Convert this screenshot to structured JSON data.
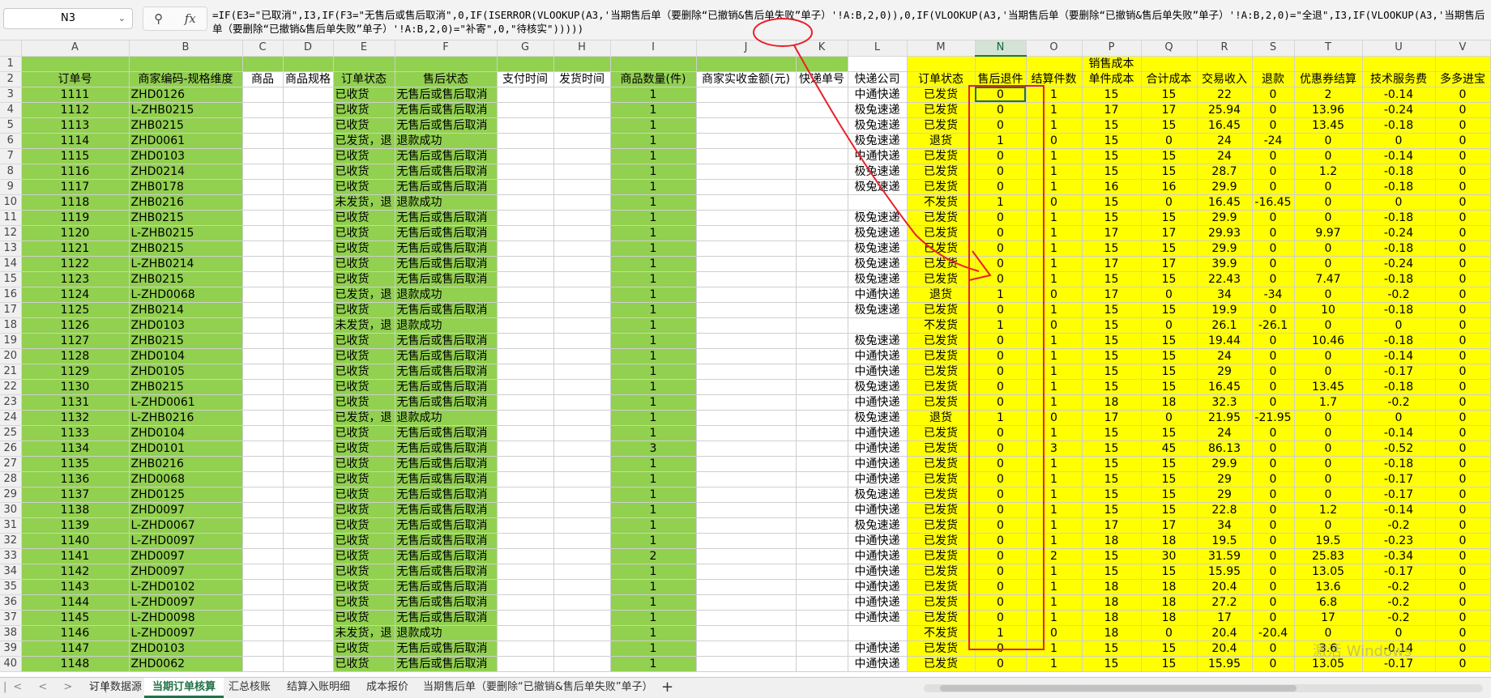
{
  "name_box": "N3",
  "fx_icons": [
    "zoom-icon",
    "function-icon"
  ],
  "fx_label": "fx",
  "formula": "=IF(E3=\"已取消\",I3,IF(F3=\"无售后或售后取消\",0,IF(ISERROR(VLOOKUP(A3,'当期售后单（要删除“已撤销&售后单失败”单子）'!A:B,2,0)),0,IF(VLOOKUP(A3,'当期售后单（要删除“已撤销&售后单失败”单子）'!A:B,2,0)=\"全退\",I3,IF(VLOOKUP(A3,'当期售后单（要删除“已撤销&售后单失败”单子）'!A:B,2,0)=\"补寄\",0,\"待核实\")))))",
  "columns": [
    {
      "letter": "A",
      "width": 133
    },
    {
      "letter": "B",
      "width": 140
    },
    {
      "letter": "C",
      "width": 50
    },
    {
      "letter": "D",
      "width": 62
    },
    {
      "letter": "E",
      "width": 76
    },
    {
      "letter": "F",
      "width": 126
    },
    {
      "letter": "G",
      "width": 70
    },
    {
      "letter": "H",
      "width": 70
    },
    {
      "letter": "I",
      "width": 106
    },
    {
      "letter": "J",
      "width": 123
    },
    {
      "letter": "K",
      "width": 64
    },
    {
      "letter": "L",
      "width": 73
    },
    {
      "letter": "M",
      "width": 84
    },
    {
      "letter": "N",
      "width": 63
    },
    {
      "letter": "O",
      "width": 69
    },
    {
      "letter": "P",
      "width": 73
    },
    {
      "letter": "Q",
      "width": 69
    },
    {
      "letter": "R",
      "width": 68
    },
    {
      "letter": "S",
      "width": 52
    },
    {
      "letter": "T",
      "width": 84
    },
    {
      "letter": "U",
      "width": 90
    },
    {
      "letter": "V",
      "width": 68
    }
  ],
  "row1": {
    "merged_title": "销售成本"
  },
  "headers": [
    "订单号",
    "商家编码-规格维度",
    "商品",
    "商品规格",
    "订单状态",
    "售后状态",
    "支付时间",
    "发货时间",
    "商品数量(件)",
    "商家实收金额(元)",
    "快递单号",
    "快递公司",
    "订单状态",
    "售后退件",
    "结算件数",
    "单件成本",
    "合计成本",
    "交易收入",
    "退款",
    "优惠券结算",
    "技术服务费",
    "多多进宝"
  ],
  "rows": [
    {
      "r": "3",
      "a": "1111",
      "b": "ZHD0126",
      "e": "已收货",
      "f": "无售后或售后取消",
      "i": "1",
      "l": "中通快递",
      "m": "已发货",
      "n": "0",
      "o": "1",
      "p": "15",
      "q": "15",
      "rr": "22",
      "s": "0",
      "t": "2",
      "u": "-0.14",
      "v": "0"
    },
    {
      "r": "4",
      "a": "1112",
      "b": "L-ZHB0215",
      "e": "已收货",
      "f": "无售后或售后取消",
      "i": "1",
      "l": "极兔速递",
      "m": "已发货",
      "n": "0",
      "o": "1",
      "p": "17",
      "q": "17",
      "rr": "25.94",
      "s": "0",
      "t": "13.96",
      "u": "-0.24",
      "v": "0"
    },
    {
      "r": "5",
      "a": "1113",
      "b": "ZHB0215",
      "e": "已收货",
      "f": "无售后或售后取消",
      "i": "1",
      "l": "极兔速递",
      "m": "已发货",
      "n": "0",
      "o": "1",
      "p": "15",
      "q": "15",
      "rr": "16.45",
      "s": "0",
      "t": "13.45",
      "u": "-0.18",
      "v": "0"
    },
    {
      "r": "6",
      "a": "1114",
      "b": "ZHD0061",
      "e": "已发货，退",
      "f": "退款成功",
      "i": "1",
      "l": "极兔速递",
      "m": "退货",
      "n": "1",
      "o": "0",
      "p": "15",
      "q": "0",
      "rr": "24",
      "s": "-24",
      "t": "0",
      "u": "0",
      "v": "0"
    },
    {
      "r": "7",
      "a": "1115",
      "b": "ZHD0103",
      "e": "已收货",
      "f": "无售后或售后取消",
      "i": "1",
      "l": "中通快递",
      "m": "已发货",
      "n": "0",
      "o": "1",
      "p": "15",
      "q": "15",
      "rr": "24",
      "s": "0",
      "t": "0",
      "u": "-0.14",
      "v": "0"
    },
    {
      "r": "8",
      "a": "1116",
      "b": "ZHD0214",
      "e": "已收货",
      "f": "无售后或售后取消",
      "i": "1",
      "l": "极兔速递",
      "m": "已发货",
      "n": "0",
      "o": "1",
      "p": "15",
      "q": "15",
      "rr": "28.7",
      "s": "0",
      "t": "1.2",
      "u": "-0.18",
      "v": "0"
    },
    {
      "r": "9",
      "a": "1117",
      "b": "ZHB0178",
      "e": "已收货",
      "f": "无售后或售后取消",
      "i": "1",
      "l": "极兔速递",
      "m": "已发货",
      "n": "0",
      "o": "1",
      "p": "16",
      "q": "16",
      "rr": "29.9",
      "s": "0",
      "t": "0",
      "u": "-0.18",
      "v": "0"
    },
    {
      "r": "10",
      "a": "1118",
      "b": "ZHB0216",
      "e": "未发货，退",
      "f": "退款成功",
      "i": "1",
      "l": "",
      "m": "不发货",
      "n": "1",
      "o": "0",
      "p": "15",
      "q": "0",
      "rr": "16.45",
      "s": "-16.45",
      "t": "0",
      "u": "0",
      "v": "0"
    },
    {
      "r": "11",
      "a": "1119",
      "b": "ZHB0215",
      "e": "已收货",
      "f": "无售后或售后取消",
      "i": "1",
      "l": "极兔速递",
      "m": "已发货",
      "n": "0",
      "o": "1",
      "p": "15",
      "q": "15",
      "rr": "29.9",
      "s": "0",
      "t": "0",
      "u": "-0.18",
      "v": "0"
    },
    {
      "r": "12",
      "a": "1120",
      "b": "L-ZHB0215",
      "e": "已收货",
      "f": "无售后或售后取消",
      "i": "1",
      "l": "极兔速递",
      "m": "已发货",
      "n": "0",
      "o": "1",
      "p": "17",
      "q": "17",
      "rr": "29.93",
      "s": "0",
      "t": "9.97",
      "u": "-0.24",
      "v": "0"
    },
    {
      "r": "13",
      "a": "1121",
      "b": "ZHB0215",
      "e": "已收货",
      "f": "无售后或售后取消",
      "i": "1",
      "l": "极兔速递",
      "m": "已发货",
      "n": "0",
      "o": "1",
      "p": "15",
      "q": "15",
      "rr": "29.9",
      "s": "0",
      "t": "0",
      "u": "-0.18",
      "v": "0"
    },
    {
      "r": "14",
      "a": "1122",
      "b": "L-ZHB0214",
      "e": "已收货",
      "f": "无售后或售后取消",
      "i": "1",
      "l": "极兔速递",
      "m": "已发货",
      "n": "0",
      "o": "1",
      "p": "17",
      "q": "17",
      "rr": "39.9",
      "s": "0",
      "t": "0",
      "u": "-0.24",
      "v": "0"
    },
    {
      "r": "15",
      "a": "1123",
      "b": "ZHB0215",
      "e": "已收货",
      "f": "无售后或售后取消",
      "i": "1",
      "l": "极兔速递",
      "m": "已发货",
      "n": "0",
      "o": "1",
      "p": "15",
      "q": "15",
      "rr": "22.43",
      "s": "0",
      "t": "7.47",
      "u": "-0.18",
      "v": "0"
    },
    {
      "r": "16",
      "a": "1124",
      "b": "L-ZHD0068",
      "e": "已发货，退",
      "f": "退款成功",
      "i": "1",
      "l": "中通快递",
      "m": "退货",
      "n": "1",
      "o": "0",
      "p": "17",
      "q": "0",
      "rr": "34",
      "s": "-34",
      "t": "0",
      "u": "-0.2",
      "v": "0"
    },
    {
      "r": "17",
      "a": "1125",
      "b": "ZHB0214",
      "e": "已收货",
      "f": "无售后或售后取消",
      "i": "1",
      "l": "极兔速递",
      "m": "已发货",
      "n": "0",
      "o": "1",
      "p": "15",
      "q": "15",
      "rr": "19.9",
      "s": "0",
      "t": "10",
      "u": "-0.18",
      "v": "0"
    },
    {
      "r": "18",
      "a": "1126",
      "b": "ZHD0103",
      "e": "未发货，退",
      "f": "退款成功",
      "i": "1",
      "l": "",
      "m": "不发货",
      "n": "1",
      "o": "0",
      "p": "15",
      "q": "0",
      "rr": "26.1",
      "s": "-26.1",
      "t": "0",
      "u": "0",
      "v": "0"
    },
    {
      "r": "19",
      "a": "1127",
      "b": "ZHB0215",
      "e": "已收货",
      "f": "无售后或售后取消",
      "i": "1",
      "l": "极兔速递",
      "m": "已发货",
      "n": "0",
      "o": "1",
      "p": "15",
      "q": "15",
      "rr": "19.44",
      "s": "0",
      "t": "10.46",
      "u": "-0.18",
      "v": "0"
    },
    {
      "r": "20",
      "a": "1128",
      "b": "ZHD0104",
      "e": "已收货",
      "f": "无售后或售后取消",
      "i": "1",
      "l": "中通快递",
      "m": "已发货",
      "n": "0",
      "o": "1",
      "p": "15",
      "q": "15",
      "rr": "24",
      "s": "0",
      "t": "0",
      "u": "-0.14",
      "v": "0"
    },
    {
      "r": "21",
      "a": "1129",
      "b": "ZHD0105",
      "e": "已收货",
      "f": "无售后或售后取消",
      "i": "1",
      "l": "中通快递",
      "m": "已发货",
      "n": "0",
      "o": "1",
      "p": "15",
      "q": "15",
      "rr": "29",
      "s": "0",
      "t": "0",
      "u": "-0.17",
      "v": "0"
    },
    {
      "r": "22",
      "a": "1130",
      "b": "ZHB0215",
      "e": "已收货",
      "f": "无售后或售后取消",
      "i": "1",
      "l": "极兔速递",
      "m": "已发货",
      "n": "0",
      "o": "1",
      "p": "15",
      "q": "15",
      "rr": "16.45",
      "s": "0",
      "t": "13.45",
      "u": "-0.18",
      "v": "0"
    },
    {
      "r": "23",
      "a": "1131",
      "b": "L-ZHD0061",
      "e": "已收货",
      "f": "无售后或售后取消",
      "i": "1",
      "l": "中通快递",
      "m": "已发货",
      "n": "0",
      "o": "1",
      "p": "18",
      "q": "18",
      "rr": "32.3",
      "s": "0",
      "t": "1.7",
      "u": "-0.2",
      "v": "0"
    },
    {
      "r": "24",
      "a": "1132",
      "b": "L-ZHB0216",
      "e": "已发货，退",
      "f": "退款成功",
      "i": "1",
      "l": "极兔速递",
      "m": "退货",
      "n": "1",
      "o": "0",
      "p": "17",
      "q": "0",
      "rr": "21.95",
      "s": "-21.95",
      "t": "0",
      "u": "0",
      "v": "0"
    },
    {
      "r": "25",
      "a": "1133",
      "b": "ZHD0104",
      "e": "已收货",
      "f": "无售后或售后取消",
      "i": "1",
      "l": "中通快递",
      "m": "已发货",
      "n": "0",
      "o": "1",
      "p": "15",
      "q": "15",
      "rr": "24",
      "s": "0",
      "t": "0",
      "u": "-0.14",
      "v": "0"
    },
    {
      "r": "26",
      "a": "1134",
      "b": "ZHD0101",
      "e": "已收货",
      "f": "无售后或售后取消",
      "i": "3",
      "l": "中通快递",
      "m": "已发货",
      "n": "0",
      "o": "3",
      "p": "15",
      "q": "45",
      "rr": "86.13",
      "s": "0",
      "t": "0",
      "u": "-0.52",
      "v": "0"
    },
    {
      "r": "27",
      "a": "1135",
      "b": "ZHB0216",
      "e": "已收货",
      "f": "无售后或售后取消",
      "i": "1",
      "l": "中通快递",
      "m": "已发货",
      "n": "0",
      "o": "1",
      "p": "15",
      "q": "15",
      "rr": "29.9",
      "s": "0",
      "t": "0",
      "u": "-0.18",
      "v": "0"
    },
    {
      "r": "28",
      "a": "1136",
      "b": "ZHD0068",
      "e": "已收货",
      "f": "无售后或售后取消",
      "i": "1",
      "l": "中通快递",
      "m": "已发货",
      "n": "0",
      "o": "1",
      "p": "15",
      "q": "15",
      "rr": "29",
      "s": "0",
      "t": "0",
      "u": "-0.17",
      "v": "0"
    },
    {
      "r": "29",
      "a": "1137",
      "b": "ZHD0125",
      "e": "已收货",
      "f": "无售后或售后取消",
      "i": "1",
      "l": "极兔速递",
      "m": "已发货",
      "n": "0",
      "o": "1",
      "p": "15",
      "q": "15",
      "rr": "29",
      "s": "0",
      "t": "0",
      "u": "-0.17",
      "v": "0"
    },
    {
      "r": "30",
      "a": "1138",
      "b": "ZHD0097",
      "e": "已收货",
      "f": "无售后或售后取消",
      "i": "1",
      "l": "中通快递",
      "m": "已发货",
      "n": "0",
      "o": "1",
      "p": "15",
      "q": "15",
      "rr": "22.8",
      "s": "0",
      "t": "1.2",
      "u": "-0.14",
      "v": "0"
    },
    {
      "r": "31",
      "a": "1139",
      "b": "L-ZHD0067",
      "e": "已收货",
      "f": "无售后或售后取消",
      "i": "1",
      "l": "极兔速递",
      "m": "已发货",
      "n": "0",
      "o": "1",
      "p": "17",
      "q": "17",
      "rr": "34",
      "s": "0",
      "t": "0",
      "u": "-0.2",
      "v": "0"
    },
    {
      "r": "32",
      "a": "1140",
      "b": "L-ZHD0097",
      "e": "已收货",
      "f": "无售后或售后取消",
      "i": "1",
      "l": "中通快递",
      "m": "已发货",
      "n": "0",
      "o": "1",
      "p": "18",
      "q": "18",
      "rr": "19.5",
      "s": "0",
      "t": "19.5",
      "u": "-0.23",
      "v": "0"
    },
    {
      "r": "33",
      "a": "1141",
      "b": "ZHD0097",
      "e": "已收货",
      "f": "无售后或售后取消",
      "i": "2",
      "l": "中通快递",
      "m": "已发货",
      "n": "0",
      "o": "2",
      "p": "15",
      "q": "30",
      "rr": "31.59",
      "s": "0",
      "t": "25.83",
      "u": "-0.34",
      "v": "0"
    },
    {
      "r": "34",
      "a": "1142",
      "b": "ZHD0097",
      "e": "已收货",
      "f": "无售后或售后取消",
      "i": "1",
      "l": "中通快递",
      "m": "已发货",
      "n": "0",
      "o": "1",
      "p": "15",
      "q": "15",
      "rr": "15.95",
      "s": "0",
      "t": "13.05",
      "u": "-0.17",
      "v": "0"
    },
    {
      "r": "35",
      "a": "1143",
      "b": "L-ZHD0102",
      "e": "已收货",
      "f": "无售后或售后取消",
      "i": "1",
      "l": "中通快递",
      "m": "已发货",
      "n": "0",
      "o": "1",
      "p": "18",
      "q": "18",
      "rr": "20.4",
      "s": "0",
      "t": "13.6",
      "u": "-0.2",
      "v": "0"
    },
    {
      "r": "36",
      "a": "1144",
      "b": "L-ZHD0097",
      "e": "已收货",
      "f": "无售后或售后取消",
      "i": "1",
      "l": "中通快递",
      "m": "已发货",
      "n": "0",
      "o": "1",
      "p": "18",
      "q": "18",
      "rr": "27.2",
      "s": "0",
      "t": "6.8",
      "u": "-0.2",
      "v": "0"
    },
    {
      "r": "37",
      "a": "1145",
      "b": "L-ZHD0098",
      "e": "已收货",
      "f": "无售后或售后取消",
      "i": "1",
      "l": "中通快递",
      "m": "已发货",
      "n": "0",
      "o": "1",
      "p": "18",
      "q": "18",
      "rr": "17",
      "s": "0",
      "t": "17",
      "u": "-0.2",
      "v": "0"
    },
    {
      "r": "38",
      "a": "1146",
      "b": "L-ZHD0097",
      "e": "未发货，退",
      "f": "退款成功",
      "i": "1",
      "l": "",
      "m": "不发货",
      "n": "1",
      "o": "0",
      "p": "18",
      "q": "0",
      "rr": "20.4",
      "s": "-20.4",
      "t": "0",
      "u": "0",
      "v": "0"
    },
    {
      "r": "39",
      "a": "1147",
      "b": "ZHD0103",
      "e": "已收货",
      "f": "无售后或售后取消",
      "i": "1",
      "l": "中通快递",
      "m": "已发货",
      "n": "0",
      "o": "1",
      "p": "15",
      "q": "15",
      "rr": "20.4",
      "s": "0",
      "t": "3.6",
      "u": "-0.14",
      "v": "0"
    },
    {
      "r": "40",
      "a": "1148",
      "b": "ZHD0062",
      "e": "已收货",
      "f": "无售后或售后取消",
      "i": "1",
      "l": "中通快递",
      "m": "已发货",
      "n": "0",
      "o": "1",
      "p": "15",
      "q": "15",
      "rr": "15.95",
      "s": "0",
      "t": "13.05",
      "u": "-0.17",
      "v": "0"
    }
  ],
  "sheet_tabs": [
    "订单数据源",
    "当期订单核算",
    "汇总核账",
    "结算入账明细",
    "成本报价",
    "当期售后单（要删除“已撤销&售后单失败”单子）"
  ],
  "active_tab": "当期订单核算",
  "tab_nav": [
    "|<",
    "<",
    ">",
    ">|"
  ],
  "add_sheet": "+",
  "watermark": "激活 Windows",
  "colors": {
    "green": "#92d050",
    "yellow": "#ffff00",
    "annotation": "#e8202a",
    "accent": "#217346"
  }
}
